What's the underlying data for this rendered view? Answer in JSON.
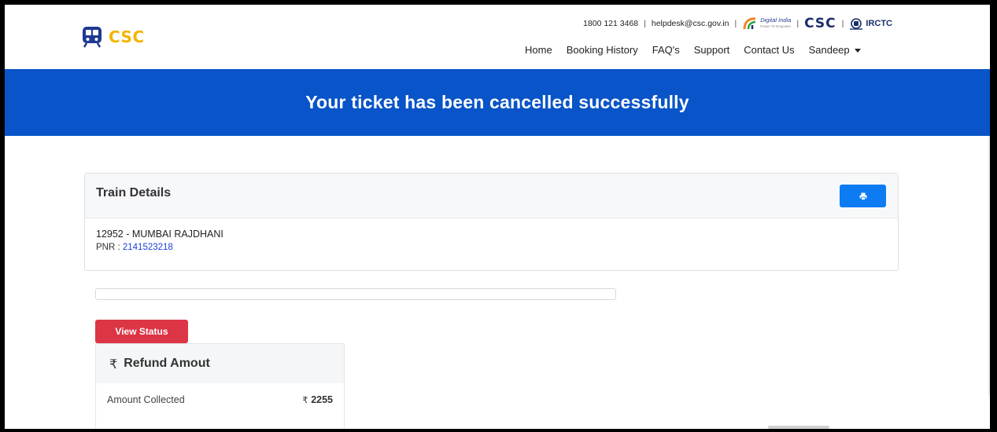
{
  "header": {
    "logo_text": "CSC",
    "topbar": {
      "phone": "1800 121 3468",
      "separator": "|",
      "email": "helpdesk@csc.gov.in",
      "digital_india": "Digital India",
      "digital_india_tagline": "Power To Empower",
      "csc_logo": "CSC",
      "irctc_logo": "IRCTC"
    },
    "nav": [
      {
        "label": "Home",
        "active": true
      },
      {
        "label": "Booking History",
        "active": false
      },
      {
        "label": "FAQ's",
        "active": false
      },
      {
        "label": "Support",
        "active": false
      },
      {
        "label": "Contact Us",
        "active": false
      },
      {
        "label": "Sandeep",
        "active": false
      }
    ]
  },
  "banner": {
    "title": "Your ticket has been cancelled successfully",
    "color": "#0854c8"
  },
  "train_details": {
    "title": "Train Details",
    "print_icon": "print-icon",
    "train": "12952 - MUMBAI RAJDHANI",
    "pnr_label": "PNR :",
    "pnr_value": "2141523218"
  },
  "actions": {
    "view_status": "View Status"
  },
  "refund": {
    "currency_icon": "₹",
    "title": "Refund Amout",
    "rows": [
      {
        "label": "Amount Collected",
        "currency": "₹",
        "value": "2255"
      }
    ]
  },
  "colors": {
    "accent": "#0d7cf2",
    "danger": "#dc3545",
    "logo": "#f5b400",
    "pnr_link": "#1b3fd9"
  }
}
